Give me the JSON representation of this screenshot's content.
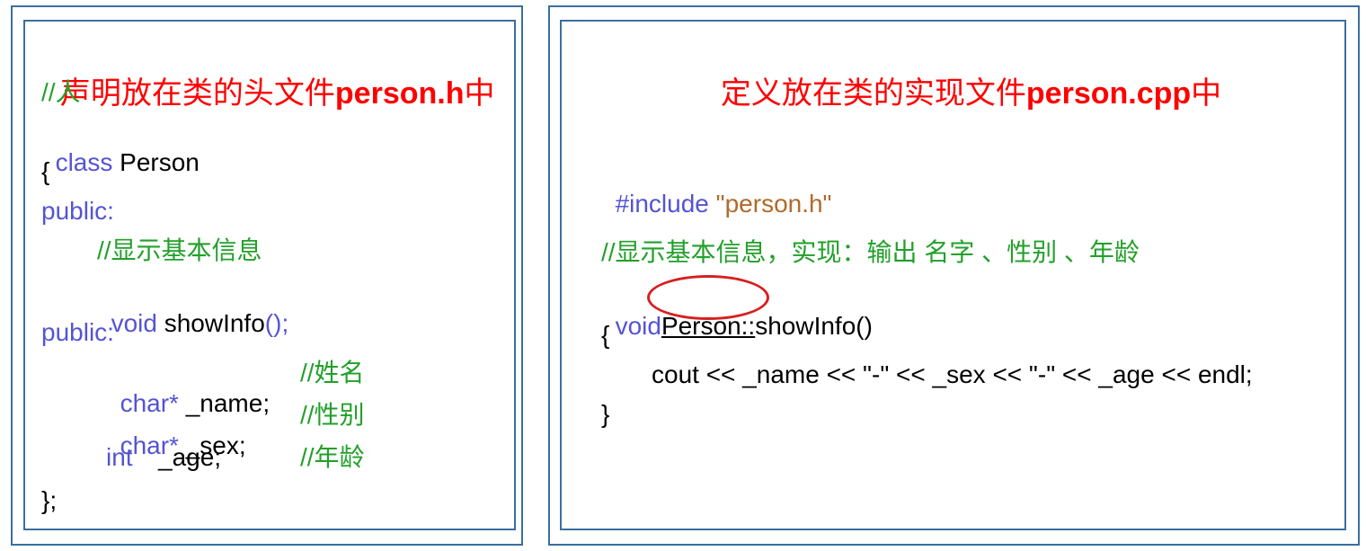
{
  "left": {
    "title_prefix": "声明放在类的头文件",
    "title_file": "person.h",
    "title_suffix": "中",
    "comment_person": "//人",
    "kw_class": "class",
    "class_name": " Person",
    "open_brace": "{",
    "kw_public1": "public:",
    "comment_show": "//显示基本信息",
    "kw_void": "void",
    "show_decl": " showInfo",
    "parens": "();",
    "kw_public2": "public:",
    "kw_char1": "char*",
    "name_field": " _name;",
    "comment_name": "//姓名",
    "kw_char2": "char*",
    "sex_field": " _sex;",
    "comment_sex": "//性别",
    "kw_int": "int",
    "age_field": "_age;",
    "comment_age": "//年龄",
    "close_brace": "};"
  },
  "right": {
    "title_prefix": "定义放在类的实现文件",
    "title_file": "person.cpp",
    "title_suffix": "中",
    "kw_include": "#include",
    "include_file": " \"person.h\"",
    "comment_show": "//显示基本信息，实现：输出 名字 、性别 、年龄",
    "kw_void": "void",
    "scope": "Person::",
    "func_name": "showInfo()",
    "open_brace": "{",
    "body": "cout << _name << \"-\" << _sex << \"-\" << _age << endl;",
    "close_brace": "}"
  },
  "colors": {
    "keyword": "#5454d4",
    "comment": "#22a02a",
    "string": "#b06a2a",
    "title": "#ff0000",
    "border": "#3a6f9e",
    "highlight_ellipse": "#d62020"
  }
}
